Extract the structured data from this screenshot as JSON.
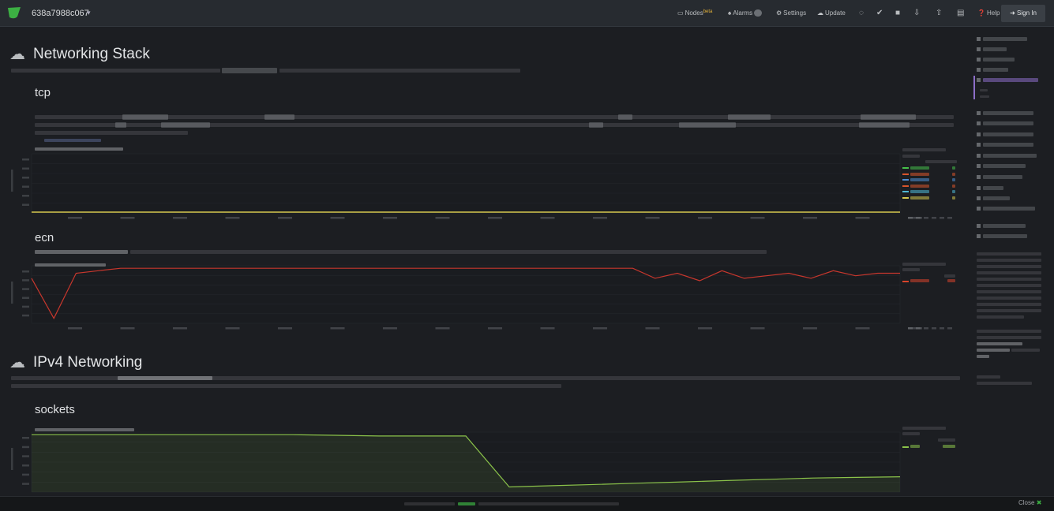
{
  "header": {
    "hostname": "638a7988c067",
    "nav": {
      "nodes_label": "Nodes",
      "nodes_badge": "beta",
      "alarms_label": "Alarms",
      "settings_label": "Settings",
      "update_label": "Update",
      "help_label": "Help",
      "signin_label": "Sign In"
    }
  },
  "sections": {
    "networking_stack": {
      "title": "Networking Stack",
      "description": ""
    },
    "tcp": {
      "title": "tcp",
      "description": "",
      "chart_title": "",
      "show_more": ""
    },
    "ecn": {
      "title": "ecn",
      "description": "",
      "chart_title": ""
    },
    "ipv4_networking": {
      "title": "IPv4 Networking",
      "description": ""
    },
    "sockets": {
      "title": "sockets",
      "chart_title": ""
    }
  },
  "legend": {
    "tcp": {
      "series_colors": [
        "#46c24a",
        "#d9552b",
        "#4f8fd6",
        "#d9552b",
        "#4fb8d6",
        "#d6c84f"
      ]
    },
    "ecn": {
      "series_colors": [
        "#d9442b"
      ]
    },
    "sockets": {
      "series_colors": [
        "#8bc34a"
      ]
    }
  },
  "colors": {
    "accent_green": "#3cb043",
    "ecn_line": "#c8372d",
    "tcp_line": "#d6c84f",
    "sockets_line": "#8bc34a",
    "active_menu": "#8c6ec8"
  },
  "footer": {
    "message": "",
    "close_label": "Close"
  },
  "chart_data": [
    {
      "type": "line",
      "series": [
        {
          "values": [
            0,
            0,
            0,
            0,
            0,
            0,
            0,
            0,
            0,
            0,
            0,
            0,
            0,
            0,
            0,
            0,
            0,
            0,
            0,
            0
          ]
        }
      ]
    },
    {
      "type": "line",
      "series": [
        {
          "values": [
            -20,
            -100,
            -10,
            -5,
            0,
            0,
            0,
            0,
            0,
            0,
            0,
            0,
            0,
            0,
            0,
            0,
            0,
            0,
            0,
            0,
            0,
            0,
            0,
            0,
            0,
            0,
            0,
            0,
            -20,
            -10,
            -25,
            -5,
            -20,
            -15,
            -10,
            -20,
            -5,
            -15,
            -10,
            -10
          ]
        }
      ]
    },
    {
      "type": "area",
      "series": [
        {
          "values": [
            1050,
            1050,
            1050,
            1050,
            1050,
            1050,
            1050,
            1045,
            1040,
            1040,
            1040,
            640,
            650,
            660,
            670,
            680,
            690,
            700,
            710,
            715,
            720
          ]
        }
      ]
    }
  ]
}
